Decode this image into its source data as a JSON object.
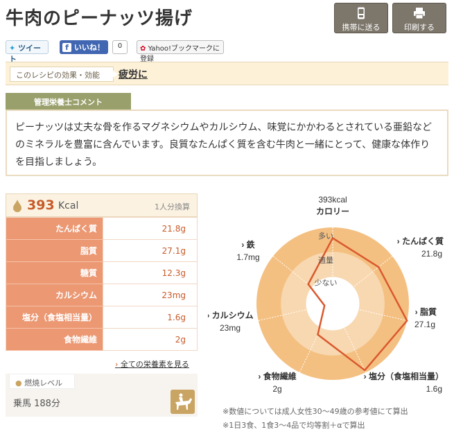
{
  "title": "牛肉のピーナッツ揚げ",
  "header_buttons": {
    "mobile": "携帯に送る",
    "print": "印刷する"
  },
  "social": {
    "tweet": "ツイート",
    "like": "いいね！",
    "like_count": "0",
    "yahoo": "Yahoo!ブックマークに登録"
  },
  "effect": {
    "label": "このレシピの効果・効能",
    "value": "疲労に"
  },
  "comment": {
    "title": "管理栄養士コメント",
    "text": "ピーナッツは丈夫な骨を作るマグネシウムやカルシウム、味覚にかかわるとされている亜鉛などのミネラルを豊富に含んでいます。良質なたんぱく質を含む牛肉と一緒にとって、健康な体作りを目指しましょう。"
  },
  "nutrition": {
    "kcal": "393",
    "kcal_unit": "Kcal",
    "per": "1人分換算",
    "rows": [
      {
        "name": "たんぱく質",
        "value": "21.8g"
      },
      {
        "name": "脂質",
        "value": "27.1g"
      },
      {
        "name": "糖質",
        "value": "12.3g"
      },
      {
        "name": "カルシウム",
        "value": "23mg"
      },
      {
        "name": "塩分（食塩相当量）",
        "value": "1.6g"
      },
      {
        "name": "食物繊維",
        "value": "2g"
      }
    ],
    "all_link": "全ての栄養素を見る"
  },
  "burn": {
    "label": "燃焼レベル",
    "value": "乗馬 188分"
  },
  "chart_data": {
    "type": "radar",
    "center_kcal": "393kcal",
    "center_label": "カロリー",
    "levels": [
      "多い",
      "適量",
      "少ない"
    ],
    "axes": [
      {
        "name": "カロリー",
        "value": ""
      },
      {
        "name": "たんぱく質",
        "value": "21.8g"
      },
      {
        "name": "脂質",
        "value": "27.1g"
      },
      {
        "name": "塩分（食塩相当量）",
        "value": "1.6g"
      },
      {
        "name": "食物繊維",
        "value": "2g"
      },
      {
        "name": "カルシウム",
        "value": "23mg"
      },
      {
        "name": "鉄",
        "value": "1.7mg"
      }
    ],
    "levels_values": [
      0.86,
      0.77,
      1.0,
      0.97,
      0.45,
      0.11,
      0.41
    ],
    "colors": {
      "outer": "#f4c082",
      "middle": "#f8d8b0",
      "inner": "#ffffff",
      "line": "#d9592e"
    }
  },
  "notes": [
    "※数値については成人女性30〜49歳の参考値にて算出",
    "※1日3食、1食3〜4品で均等割＋αで算出"
  ]
}
